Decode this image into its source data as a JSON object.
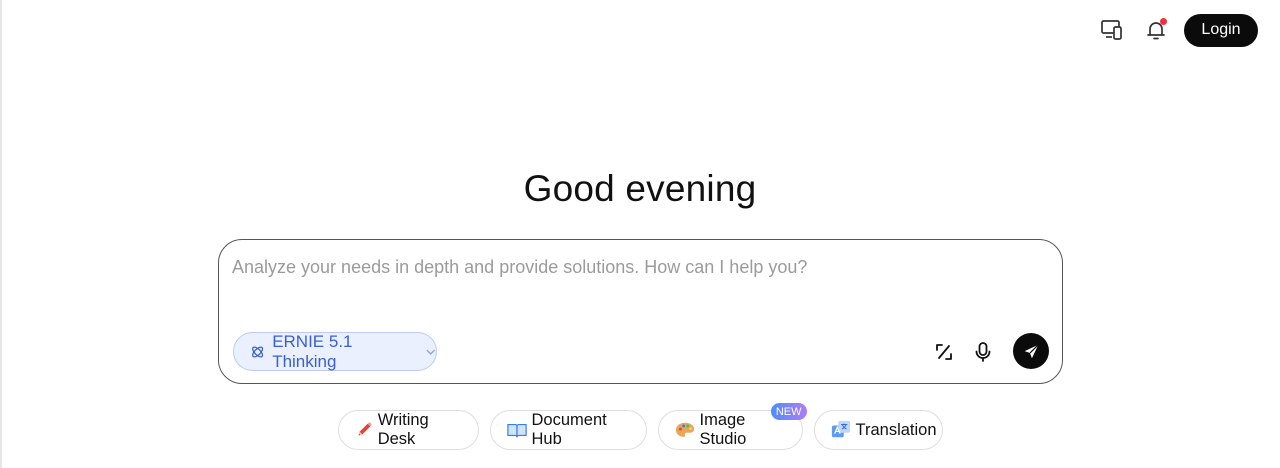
{
  "header": {
    "login_label": "Login",
    "has_notification": true
  },
  "greeting": "Good evening",
  "composer": {
    "placeholder": "Analyze your needs in depth and provide solutions. How can I help you?",
    "value": "",
    "model_label": "ERNIE 5.1 Thinking"
  },
  "quick_actions": [
    {
      "label": "Writing Desk",
      "icon": "pencil-icon"
    },
    {
      "label": "Document Hub",
      "icon": "book-icon"
    },
    {
      "label": "Image Studio",
      "icon": "palette-icon",
      "badge": "NEW"
    },
    {
      "label": "Translation",
      "icon": "translate-icon"
    }
  ],
  "colors": {
    "accent_blue": "#3a5fd0",
    "chip_bg": "#eaf0fd",
    "dark": "#0b0b0b",
    "notification_dot": "#f0303a"
  }
}
